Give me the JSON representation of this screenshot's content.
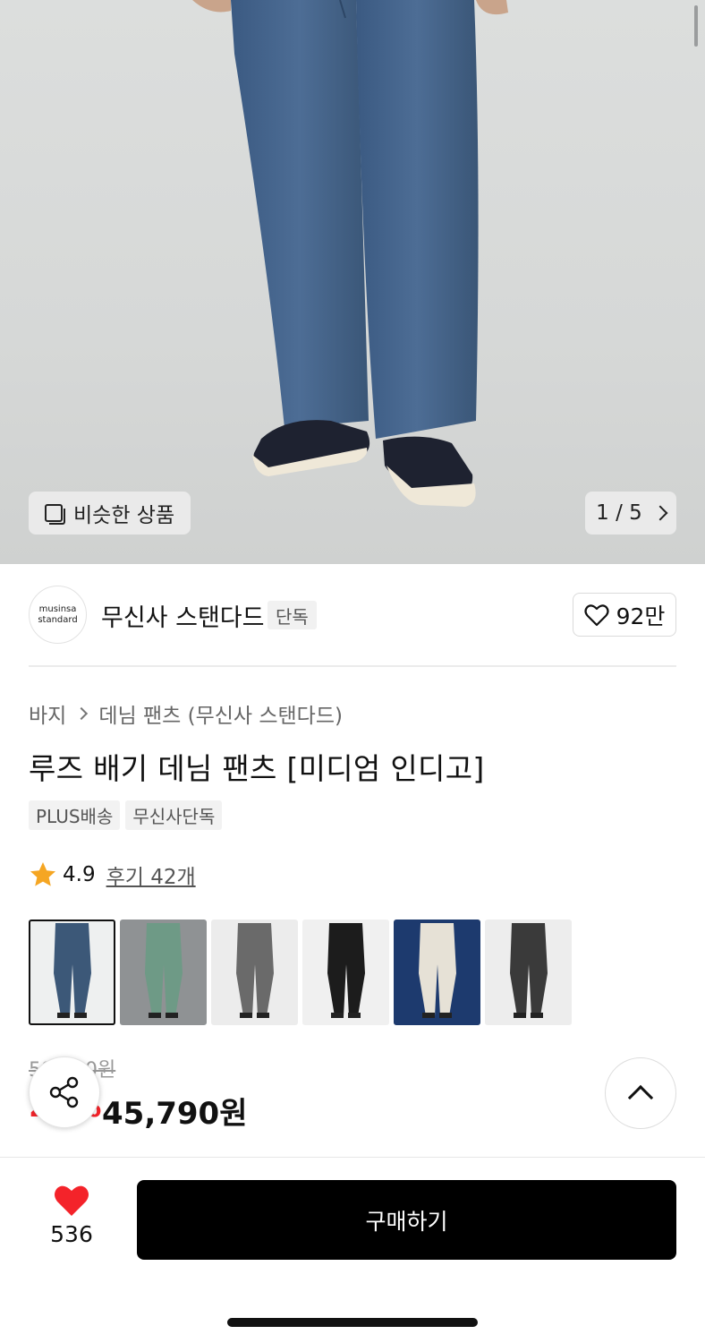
{
  "hero": {
    "similar_label": "비슷한 상품",
    "pager": "1 / 5",
    "icons": [
      "similar-items-icon",
      "chevron-right-icon"
    ]
  },
  "brand": {
    "logo_line1": "musinsa",
    "logo_line2": "standard",
    "name": "무신사 스탠다드",
    "tag": "단독",
    "likes": "92만"
  },
  "product": {
    "breadcrumb": [
      "바지",
      "데님 팬츠 (무신사 스탠다드)"
    ],
    "title": "루즈 배기 데님 팬츠 [미디엄 인디고]",
    "tags": [
      "PLUS배송",
      "무신사단독"
    ],
    "rating": "4.9",
    "reviews": "후기 42개",
    "thumbnails": [
      {
        "name": "medium-indigo",
        "bg": "#eef0f0",
        "color": "#3c5878",
        "selected": true
      },
      {
        "name": "green-model",
        "bg": "#8f9294",
        "color": "#6e9a86",
        "selected": false
      },
      {
        "name": "grey-wash",
        "bg": "#ececec",
        "color": "#6a6a6a",
        "selected": false
      },
      {
        "name": "black",
        "bg": "#f0f0f0",
        "color": "#1c1c1c",
        "selected": false
      },
      {
        "name": "ecru-model",
        "bg": "#1d3a6e",
        "color": "#e6e1d6",
        "selected": false
      },
      {
        "name": "black-wash",
        "bg": "#ededed",
        "color": "#3a3a3a",
        "selected": false
      }
    ]
  },
  "price": {
    "original": "59,900원",
    "discount": "23%",
    "final": "45,790원"
  },
  "bottom": {
    "wish_count": "536",
    "buy_label": "구매하기"
  },
  "colors": {
    "accent_red": "#f4232a",
    "star": "#f5a623",
    "button_bg": "#000000"
  }
}
